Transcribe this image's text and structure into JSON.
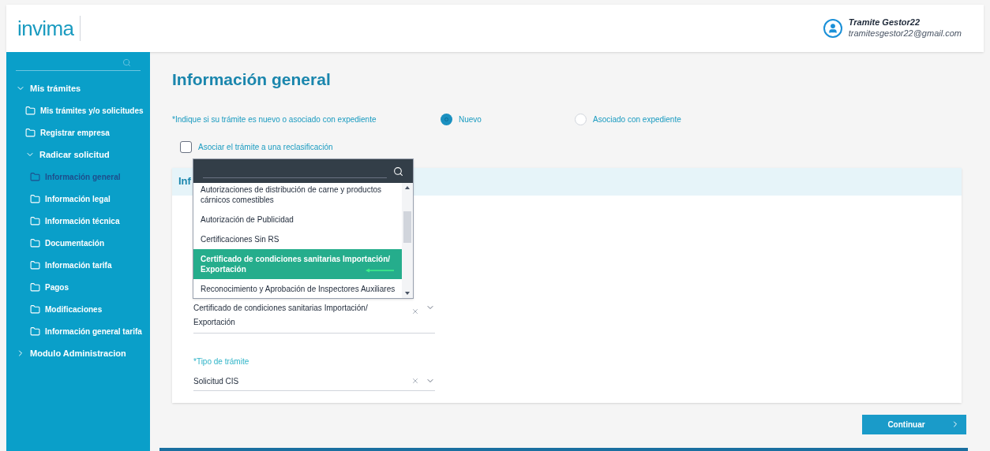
{
  "header": {
    "logo": "invima",
    "user": {
      "name": "Tramite Gestor22",
      "email": "tramitesgestor22@gmail.com"
    }
  },
  "sidebar": {
    "items": [
      {
        "label": "Mis trámites",
        "kind": "group",
        "expanded": true,
        "children": [
          {
            "label": "Mis trámites y/o solicitudes",
            "kind": "folder",
            "selected": false
          },
          {
            "label": "Registrar empresa",
            "kind": "folder",
            "selected": false
          },
          {
            "label": "Radicar solicitud",
            "kind": "group",
            "expanded": true,
            "children": [
              {
                "label": "Información general",
                "kind": "folder",
                "selected": true
              },
              {
                "label": "Información legal",
                "kind": "folder",
                "selected": false
              },
              {
                "label": "Información técnica",
                "kind": "folder",
                "selected": false
              },
              {
                "label": "Documentación",
                "kind": "folder",
                "selected": false
              },
              {
                "label": "Información tarifa",
                "kind": "folder",
                "selected": false
              },
              {
                "label": "Pagos",
                "kind": "folder",
                "selected": false
              },
              {
                "label": "Modificaciones",
                "kind": "folder",
                "selected": false
              },
              {
                "label": "Información general tarifa",
                "kind": "folder",
                "selected": false
              }
            ]
          }
        ]
      },
      {
        "label": "Modulo Administracion",
        "kind": "group",
        "expanded": false
      }
    ]
  },
  "page": {
    "title": "Información general",
    "question": "*Indique si su trámite es nuevo o asociado con expediente",
    "radios": [
      {
        "label": "Nuevo",
        "selected": true
      },
      {
        "label": "Asociado con expediente",
        "selected": false
      }
    ],
    "checkbox": {
      "label": "Asociar el trámite a una reclasificación",
      "checked": false
    },
    "card": {
      "title": "Inf",
      "fields": [
        {
          "value": "Certificado de condiciones sanitarias Importación/ Exportación"
        },
        {
          "label": "*Tipo de trámite",
          "value": "Solicitud CIS"
        }
      ]
    },
    "dropdown": {
      "options": [
        {
          "label": "Autorizaciones de distribución de carne y productos cárnicos comestibles",
          "selected": false
        },
        {
          "label": "Autorización de Publicidad",
          "selected": false
        },
        {
          "label": "Certificaciones Sin RS",
          "selected": false
        },
        {
          "label": "Certificado de condiciones sanitarias Importación/ Exportación",
          "selected": true
        },
        {
          "label": "Reconocimiento y Aprobación de Inspectores Auxiliares",
          "selected": false
        }
      ]
    },
    "continue_button": "Continuar"
  }
}
